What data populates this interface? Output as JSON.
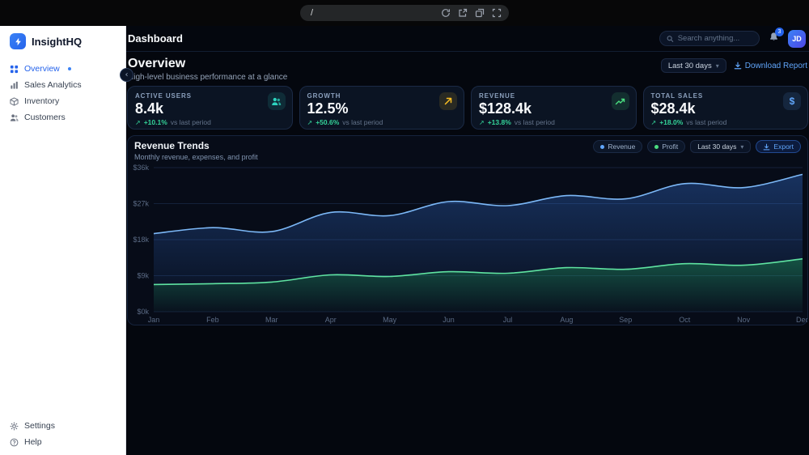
{
  "browser": {
    "url": "/"
  },
  "icons": {
    "chevron_down": "▾",
    "trend_up": "↗",
    "collapse": "‹",
    "dollar": "$"
  },
  "sidebar": {
    "brand": "InsightHQ",
    "items": [
      {
        "label": "Overview",
        "active": true
      },
      {
        "label": "Sales Analytics",
        "active": false
      },
      {
        "label": "Inventory",
        "active": false
      },
      {
        "label": "Customers",
        "active": false
      }
    ],
    "footer": [
      {
        "label": "Settings"
      },
      {
        "label": "Help"
      }
    ]
  },
  "topbar": {
    "title": "Dashboard",
    "search_placeholder": "Search anything...",
    "notification_count": "3",
    "avatar_initials": "JD"
  },
  "page": {
    "title": "Overview",
    "subtitle": "High-level business performance at a glance",
    "range_label": "Last 30 days",
    "download_label": "Download Report"
  },
  "kpis": [
    {
      "label": "ACTIVE USERS",
      "value": "8.4k",
      "delta": "+10.1%",
      "note": "vs last period",
      "icon": "users-icon",
      "color": "#2dd4bf"
    },
    {
      "label": "GROWTH",
      "value": "12.5%",
      "delta": "+50.6%",
      "note": "vs last period",
      "icon": "arrow-up-right-icon",
      "color": "#fbbf24"
    },
    {
      "label": "REVENUE",
      "value": "$128.4k",
      "delta": "+13.8%",
      "note": "vs last period",
      "icon": "trending-up-icon",
      "color": "#4ade80"
    },
    {
      "label": "TOTAL SALES",
      "value": "$28.4k",
      "delta": "+18.0%",
      "note": "vs last period",
      "icon": "dollar-icon",
      "color": "#60a5fa"
    }
  ],
  "chart": {
    "title": "Revenue Trends",
    "subtitle": "Monthly revenue, expenses, and profit",
    "legend": [
      {
        "label": "Revenue",
        "color": "#60a5fa"
      },
      {
        "label": "Profit",
        "color": "#4ade80"
      }
    ],
    "range_label": "Last 30 days",
    "export_label": "Export"
  },
  "chart_data": {
    "type": "area",
    "x": [
      "Jan",
      "Feb",
      "Mar",
      "Apr",
      "May",
      "Jun",
      "Jul",
      "Aug",
      "Sep",
      "Oct",
      "Nov",
      "Dec"
    ],
    "series": [
      {
        "name": "Revenue",
        "color": "#7cb8f7",
        "fill": "#3b82f6",
        "values": [
          19.5,
          21,
          20,
          24.8,
          24,
          27.5,
          26.5,
          29,
          28.2,
          32,
          31,
          34.3
        ]
      },
      {
        "name": "Profit",
        "color": "#5fe3a1",
        "fill": "#22c55e",
        "values": [
          6.8,
          7,
          7.4,
          9.2,
          8.8,
          10,
          9.6,
          11,
          10.6,
          12,
          11.6,
          13.2
        ]
      }
    ],
    "ylim": [
      0,
      36
    ],
    "yticks": [
      "$0k",
      "$9k",
      "$18k",
      "$27k",
      "$36k"
    ],
    "ylabel_unit": "$k",
    "grid": true,
    "legend_position": "top-right"
  }
}
